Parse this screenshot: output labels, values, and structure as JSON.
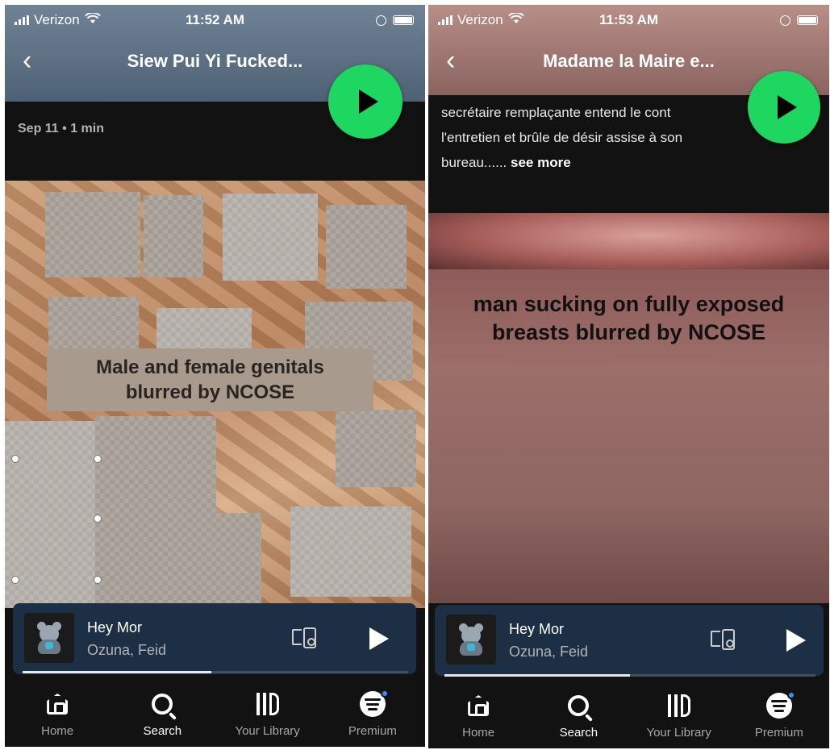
{
  "left_screen": {
    "status": {
      "carrier": "Verizon",
      "time": "11:52 AM"
    },
    "header": {
      "title": "Siew Pui Yi Fucked..."
    },
    "meta": "Sep 11 • 1 min",
    "overlay_label": [
      "Male and female genitals",
      "blurred by NCOSE"
    ],
    "player": {
      "song": "Hey Mor",
      "artist": "Ozuna, Feid",
      "progress": 0.49
    },
    "tabs": [
      "Home",
      "Search",
      "Your Library",
      "Premium"
    ],
    "active_tab": "Search"
  },
  "right_screen": {
    "status": {
      "carrier": "Verizon",
      "time": "11:53 AM"
    },
    "header": {
      "title": "Madame la Maire e..."
    },
    "description": {
      "line1": "secrétaire remplaçante entend le cont",
      "line2": "l'entretien et brûle de désir assise à son",
      "line3": "bureau......",
      "see_more": "see more"
    },
    "overlay_label": [
      "man sucking on fully exposed",
      "breasts blurred by NCOSE"
    ],
    "player": {
      "song": "Hey Mor",
      "artist": "Ozuna, Feid",
      "progress": 0.5
    },
    "tabs": [
      "Home",
      "Search",
      "Your Library",
      "Premium"
    ],
    "active_tab": "Search"
  },
  "colors": {
    "spotify_green": "#1ed760",
    "player_bg": "#1c2f44",
    "app_bg": "#121212"
  },
  "icons": [
    "back-icon",
    "play-icon",
    "devices-icon",
    "home-icon",
    "search-icon",
    "library-icon",
    "spotify-icon",
    "wifi-icon",
    "battery-icon"
  ]
}
